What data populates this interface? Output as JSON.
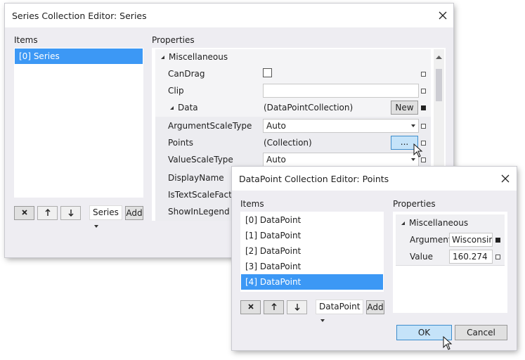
{
  "series_editor": {
    "title": "Series Collection Editor: Series",
    "items_label": "Items",
    "properties_label": "Properties",
    "items": [
      {
        "label": "[0] Series",
        "selected": true
      }
    ],
    "toolbar": {
      "delete_icon": "x-icon",
      "move_up_icon": "arrow-up-icon",
      "move_down_icon": "arrow-down-icon",
      "type_dropdown": "Series",
      "add_label": "Add"
    },
    "grid": {
      "category": "Miscellaneous",
      "rows": [
        {
          "name": "CanDrag",
          "type": "checkbox",
          "checked": false
        },
        {
          "name": "Clip",
          "type": "text",
          "value": ""
        },
        {
          "name": "Data",
          "type": "subcategory",
          "value": "(DataPointCollection)",
          "button": "New"
        },
        {
          "name": "ArgumentScaleType",
          "type": "dropdown",
          "value": "Auto"
        },
        {
          "name": "Points",
          "type": "collection",
          "value": "(Collection)",
          "button": "..."
        },
        {
          "name": "ValueScaleType",
          "type": "dropdown",
          "value": "Auto"
        },
        {
          "name": "DisplayName"
        },
        {
          "name": "IsTextScaleFactor"
        },
        {
          "name": "ShowInLegend"
        }
      ]
    }
  },
  "points_editor": {
    "title": "DataPoint Collection Editor: Points",
    "items_label": "Items",
    "properties_label": "Properties",
    "items": [
      {
        "label": "[0] DataPoint",
        "selected": false
      },
      {
        "label": "[1] DataPoint",
        "selected": false
      },
      {
        "label": "[2] DataPoint",
        "selected": false
      },
      {
        "label": "[3] DataPoint",
        "selected": false
      },
      {
        "label": "[4] DataPoint",
        "selected": true
      }
    ],
    "toolbar": {
      "type_dropdown": "DataPoint",
      "add_label": "Add"
    },
    "grid": {
      "category": "Miscellaneous",
      "rows": [
        {
          "name": "Argument",
          "value": "Wisconsin"
        },
        {
          "name": "Value",
          "value": "160.274"
        }
      ]
    },
    "ok_label": "OK",
    "cancel_label": "Cancel"
  },
  "colors": {
    "selection": "#3c98f5",
    "hot_button": "#c5e3f9",
    "window_bg": "#eeedf2"
  }
}
